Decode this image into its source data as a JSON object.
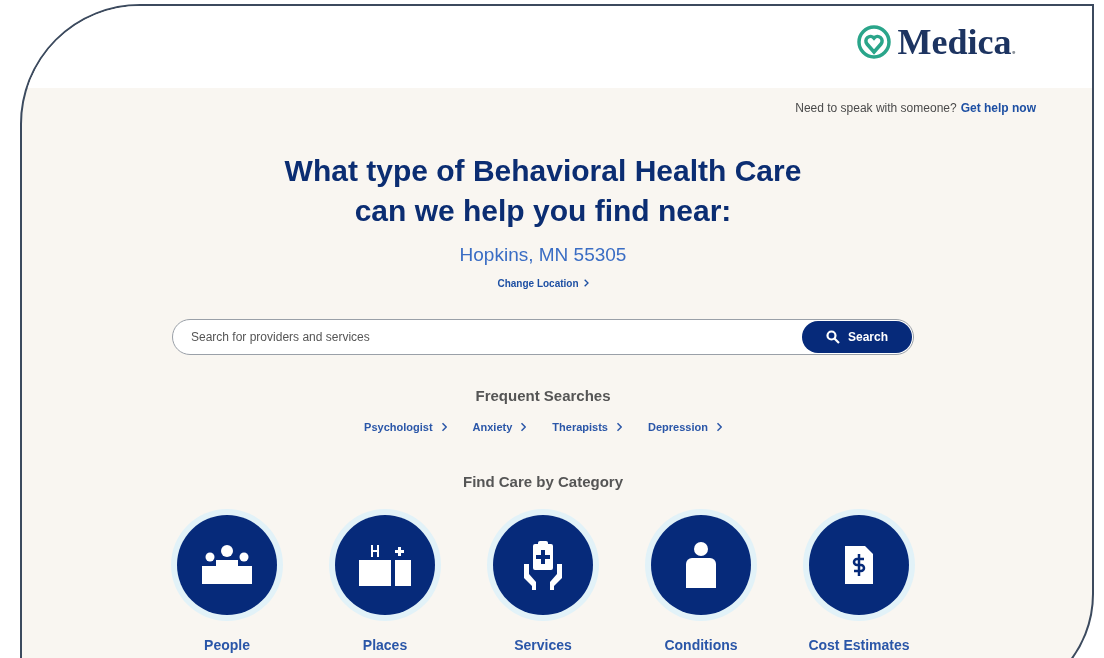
{
  "header": {
    "logo_text": "Medica",
    "logo_dot": "."
  },
  "help": {
    "text": "Need to speak with someone?",
    "link": "Get help now"
  },
  "hero": {
    "title_line_1": "What type of Behavioral Health Care",
    "title_line_2": "can we help you find near:",
    "location": "Hopkins, MN 55305",
    "change_location": "Change Location"
  },
  "search": {
    "placeholder": "Search for providers and services",
    "button": "Search"
  },
  "frequent_searches": {
    "title": "Frequent Searches",
    "items": [
      "Psychologist",
      "Anxiety",
      "Therapists",
      "Depression"
    ]
  },
  "categories": {
    "title": "Find Care by Category",
    "items": [
      {
        "label": "People",
        "kind": "people"
      },
      {
        "label": "Places",
        "kind": "places"
      },
      {
        "label": "Services",
        "kind": "services"
      },
      {
        "label": "Conditions",
        "kind": "conditions"
      },
      {
        "label": "Cost Estimates",
        "kind": "cost"
      }
    ]
  }
}
